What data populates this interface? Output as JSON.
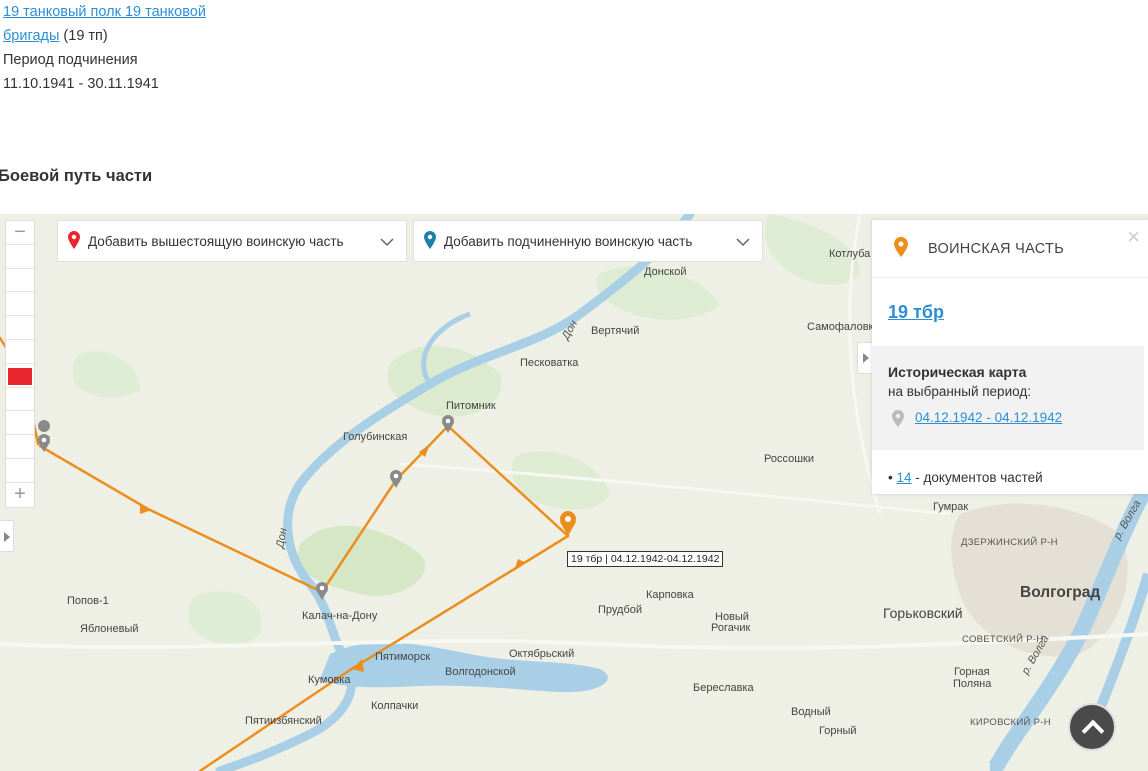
{
  "info": {
    "link_line1": "19 танковый полк 19 танковой",
    "link_line2": "бригады",
    "abbr": "(19 тп)",
    "period_label": "Период подчинения",
    "period_value": "11.10.1941 - 30.11.1941"
  },
  "section_title": "Боевой путь части",
  "map": {
    "dropdown_superior": "Добавить вышестоящую воинскую часть",
    "dropdown_subordinate": "Добавить подчиненную воинскую часть",
    "panel": {
      "header": "ВОИНСКАЯ ЧАСТЬ",
      "unit_link": "19 тбр",
      "hist_title": "Историческая карта",
      "hist_subtitle": "на выбранный период:",
      "hist_date": "04.12.1942 - 04.12.1942",
      "docs_count": "14",
      "docs_text": " - документов частей"
    },
    "tooltip": "19 тбр | 04.12.1942-04.12.1942",
    "places": {
      "donskoy": "Донской",
      "kotluban": "Котлуба",
      "vertyachiy": "Вертячий",
      "samofalovka": "Самофаловк",
      "peskovatka": "Песковатка",
      "pitomnik": "Питомник",
      "golubinskaya": "Голубинская",
      "rossoshki": "Россошки",
      "gumrak": "Гумрак",
      "dzerzh": "ДЗЕРЖИНСКИЙ Р-Н",
      "popov": "Попов-1",
      "yabloneviy": "Яблоневый",
      "kalach": "Калач-на-Дону",
      "karpovka": "Карповка",
      "prudboy": "Прудбой",
      "noviy_rogachik_1": "Новый",
      "noviy_rogachik_2": "Рогачик",
      "gorkovskiy": "Горьковский",
      "volgograd": "Волгоград",
      "sovetskiy": "СОВЕТСКИЙ Р-Н",
      "pyatimorsk": "Пятиморск",
      "oktyabrskiy": "Октябрьский",
      "volgodonskoy": "Волгодонской",
      "kumovka": "Кумовка",
      "kolpachki": "Колпачки",
      "bereslavka": "Береславка",
      "vodniy": "Водный",
      "gorniy": "Горный",
      "gornaya_1": "Горная",
      "gornaya_2": "Поляна",
      "kirovskiy": "КИРОВСКИЙ Р-Н",
      "pyatiizbyanskiy": "Пятиизбянский",
      "don_1": "Дон",
      "don_2": "Дон",
      "volga_1": "р. Волга",
      "volga_2": "р. Волга"
    }
  }
}
